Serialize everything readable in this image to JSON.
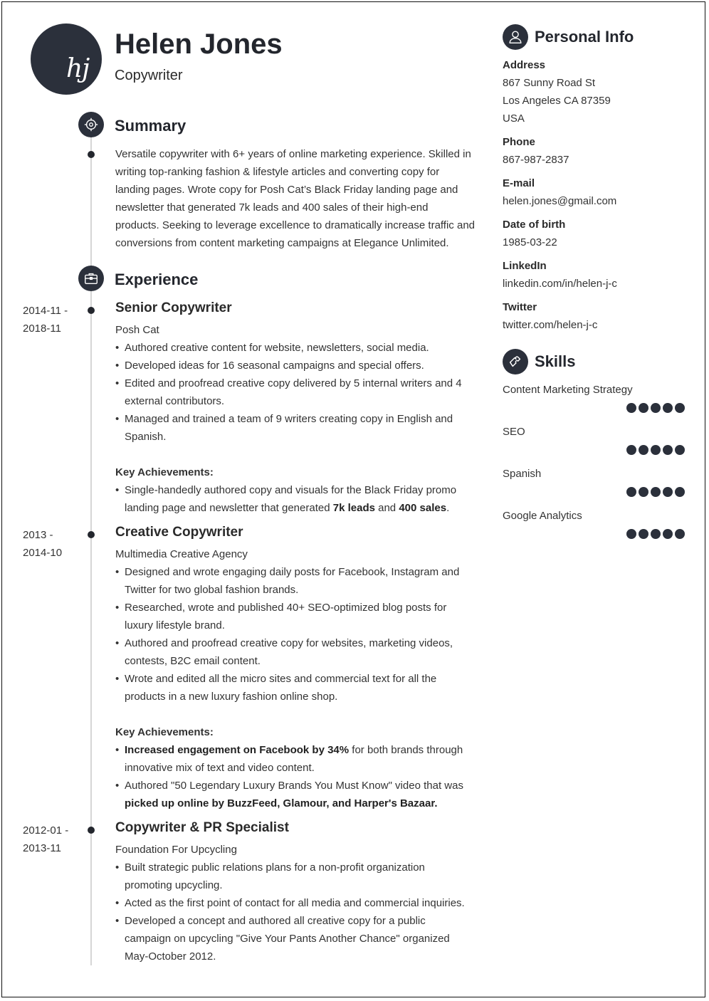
{
  "header": {
    "initials": "hj",
    "name": "Helen Jones",
    "title": "Copywriter"
  },
  "summary": {
    "heading": "Summary",
    "icon": "target-icon",
    "text": "Versatile copywriter with 6+ years of online marketing experience. Skilled in writing top-ranking fashion & lifestyle articles and converting copy for landing pages. Wrote copy for Posh Cat’s Black Friday landing page and newsletter that generated 7k leads and 400 sales of their high-end products. Seeking to leverage excellence to dramatically increase traffic and conversions from content marketing campaigns at Elegance Unlimited."
  },
  "experience": {
    "heading": "Experience",
    "icon": "briefcase-icon",
    "jobs": [
      {
        "date_start": "2014-11 -",
        "date_end": "2018-11",
        "title": "Senior Copywriter",
        "company": "Posh Cat",
        "bullets": [
          "Authored creative content for website, newsletters, social media.",
          "Developed ideas for 16 seasonal campaigns and special offers.",
          "Edited and proofread creative copy delivered by 5 internal writers and 4 external contributors.",
          "Managed and trained a team of 9 writers creating copy in English and Spanish."
        ],
        "achievements_label": "Key Achievements:",
        "achievements": [
          {
            "parts": [
              {
                "text": "Single-handedly authored copy and visuals for the Black Friday promo landing page and newsletter that generated ",
                "bold": false
              },
              {
                "text": "7k leads",
                "bold": true
              },
              {
                "text": " and ",
                "bold": false
              },
              {
                "text": "400 sales",
                "bold": true
              },
              {
                "text": ".",
                "bold": false
              }
            ]
          }
        ]
      },
      {
        "date_start": "2013 -",
        "date_end": "2014-10",
        "title": "Creative Copywriter",
        "company": "Multimedia Creative Agency",
        "bullets": [
          "Designed and wrote engaging daily posts for Facebook, Instagram and Twitter for two global fashion brands.",
          "Researched, wrote and published 40+ SEO-optimized blog posts for luxury lifestyle brand.",
          "Authored and proofread creative copy for websites, marketing videos, contests, B2C email content.",
          "Wrote and edited all the micro sites and commercial text for all the products in a new luxury fashion online shop."
        ],
        "achievements_label": "Key Achievements:",
        "achievements": [
          {
            "parts": [
              {
                "text": "Increased engagement on Facebook by 34%",
                "bold": true
              },
              {
                "text": " for both brands through innovative mix of text and video content.",
                "bold": false
              }
            ]
          },
          {
            "parts": [
              {
                "text": "Authored \"50 Legendary Luxury Brands You Must Know\" video that was ",
                "bold": false
              },
              {
                "text": "picked up online by BuzzFeed, Glamour, and Harper's Bazaar.",
                "bold": true
              }
            ]
          }
        ]
      },
      {
        "date_start": "2012-01 -",
        "date_end": "2013-11",
        "title": "Copywriter & PR Specialist",
        "company": "Foundation For Upcycling",
        "bullets": [
          "Built strategic public relations plans for a non-profit organization promoting upcycling.",
          "Acted as the first point of contact for all media and commercial inquiries.",
          "Developed a concept and authored all creative copy for a public campaign on upcycling \"Give Your Pants Another Chance\" organized May-October 2012."
        ],
        "achievements_label": "",
        "achievements": []
      }
    ]
  },
  "personal_info": {
    "heading": "Personal Info",
    "icon": "user-icon",
    "address_label": "Address",
    "address_lines": [
      "867 Sunny Road St",
      "Los Angeles CA 87359",
      "USA"
    ],
    "phone_label": "Phone",
    "phone": "867-987-2837",
    "email_label": "E-mail",
    "email": "helen.jones@gmail.com",
    "dob_label": "Date of birth",
    "dob": "1985-03-22",
    "linkedin_label": "LinkedIn",
    "linkedin": "linkedin.com/in/helen-j-c",
    "twitter_label": "Twitter",
    "twitter": "twitter.com/helen-j-c"
  },
  "skills": {
    "heading": "Skills",
    "icon": "puzzle-icon",
    "max_level": 5,
    "items": [
      {
        "name": "Content Marketing Strategy",
        "level": 5
      },
      {
        "name": "SEO",
        "level": 5
      },
      {
        "name": "Spanish",
        "level": 5
      },
      {
        "name": "Google Analytics",
        "level": 5
      }
    ]
  },
  "colors": {
    "accent": "#2b303b",
    "timeline": "#d6d6d6",
    "text": "#333333"
  }
}
